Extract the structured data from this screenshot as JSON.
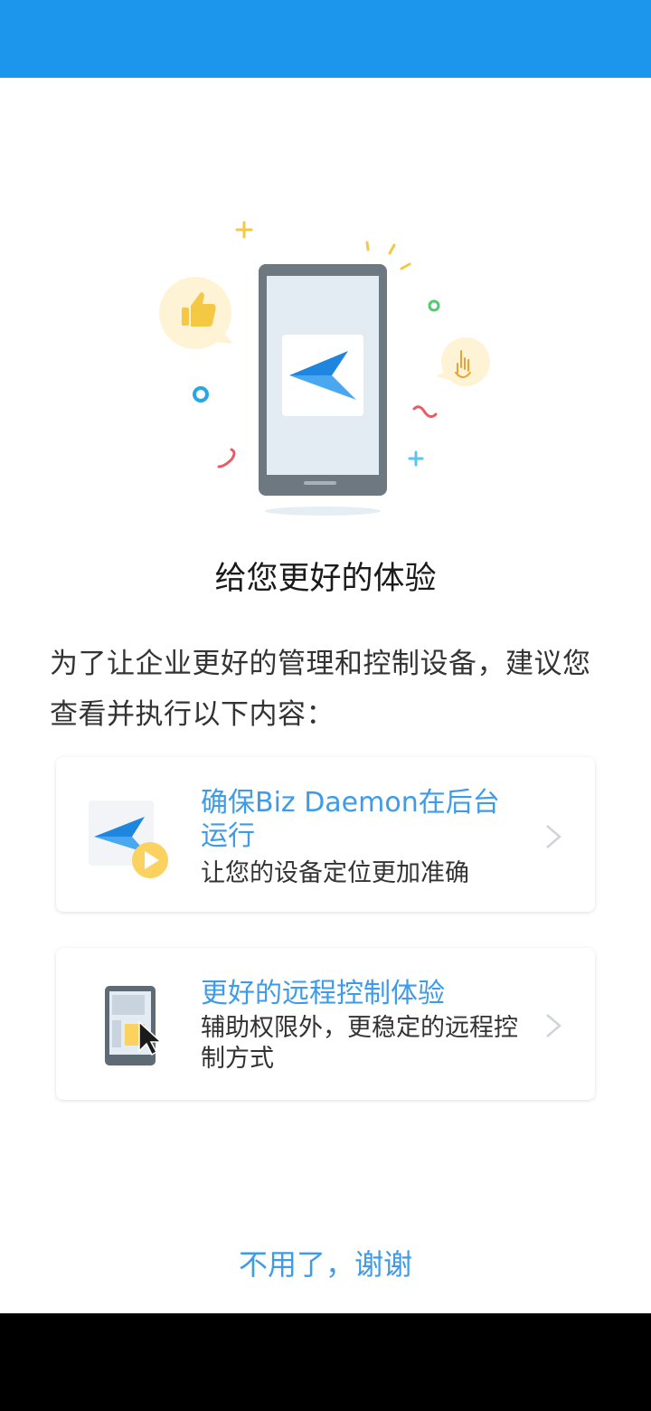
{
  "heading": "给您更好的体验",
  "intro": "为了让企业更好的管理和控制设备，建议您查看并执行以下内容：",
  "cards": [
    {
      "title": "确保Biz Daemon在后台运行",
      "description": "让您的设备定位更加准确",
      "icon": "app-play-icon"
    },
    {
      "title": "更好的远程控制体验",
      "description": "辅助权限外，更稳定的远程控制方式",
      "icon": "remote-control-icon"
    }
  ],
  "dismiss_label": "不用了，谢谢",
  "colors": {
    "status_bar": "#1c95ec",
    "accent": "#3d9be9",
    "text": "#333333",
    "nav_bar": "#000000"
  }
}
